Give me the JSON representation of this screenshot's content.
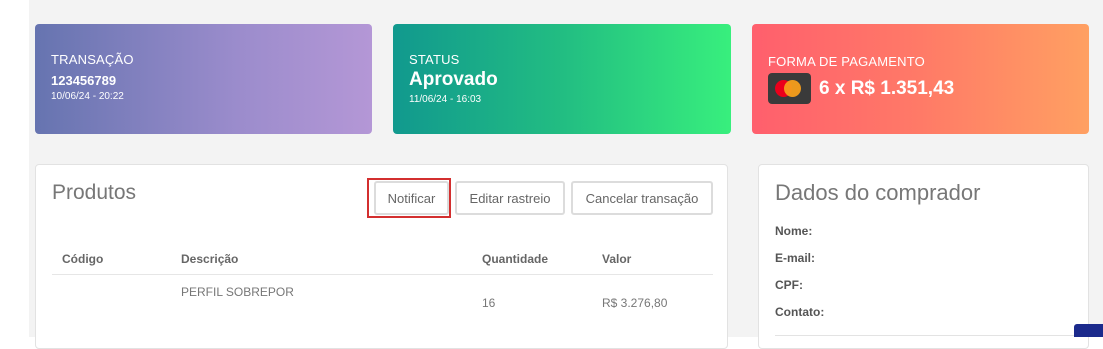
{
  "cards": {
    "transacao": {
      "label": "TRANSAÇÃO",
      "value": "123456789",
      "date": "10/06/24 - 20:22"
    },
    "status": {
      "label": "STATUS",
      "value": "Aprovado",
      "date": "11/06/24 - 16:03"
    },
    "pagamento": {
      "label": "FORMA DE PAGAMENTO",
      "icon": "mastercard-icon",
      "value": "6 x R$ 1.351,43"
    }
  },
  "produtos": {
    "title": "Produtos",
    "buttons": {
      "notificar": "Notificar",
      "editar_rastreio": "Editar rastreio",
      "cancelar": "Cancelar transação"
    },
    "columns": {
      "codigo": "Código",
      "descricao": "Descrição",
      "quantidade": "Quantidade",
      "valor": "Valor"
    },
    "rows": [
      {
        "codigo": "",
        "descricao": "PERFIL SOBREPOR",
        "quantidade": "16",
        "valor": "R$ 3.276,80"
      }
    ]
  },
  "comprador": {
    "title": "Dados do comprador",
    "fields": {
      "nome": "Nome:",
      "email": "E-mail:",
      "cpf": "CPF:",
      "contato": "Contato:"
    }
  },
  "colors": {
    "highlight": "#d32f2f",
    "transacao_gradient": [
      "#6674b0",
      "#b497d6"
    ],
    "status_gradient": [
      "#11998e",
      "#38ef7d"
    ],
    "pagamento_gradient": [
      "#ff5f6d",
      "#ffa062"
    ]
  }
}
